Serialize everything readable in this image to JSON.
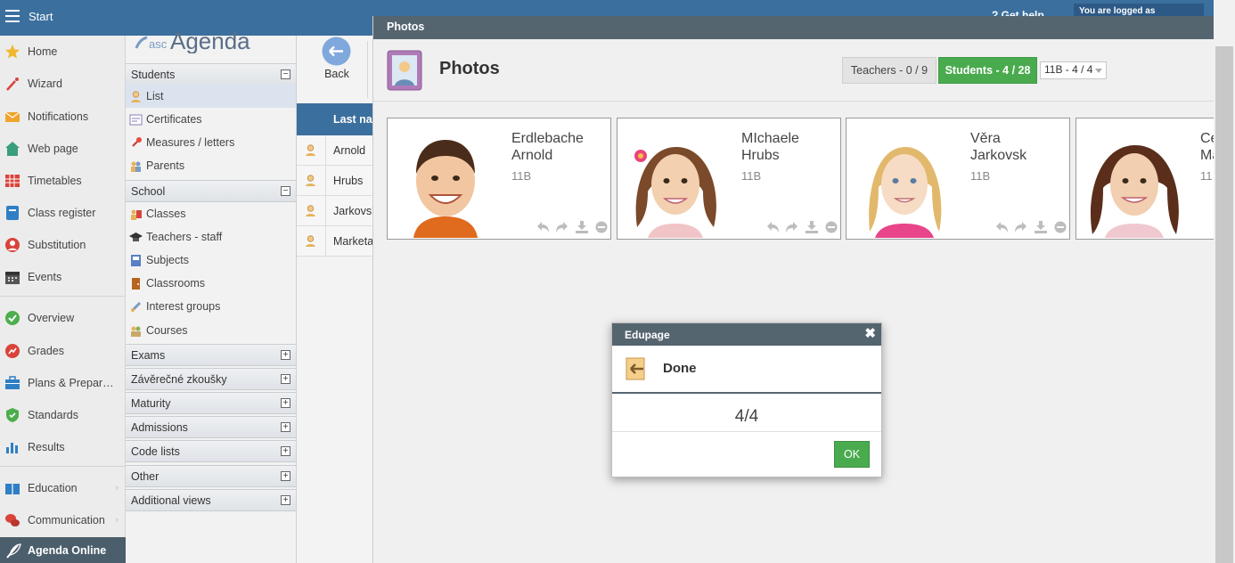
{
  "topbar": {
    "start_label": "Start",
    "help_label": "? Get help",
    "logged_label": "You are logged as"
  },
  "leftnav": {
    "items": [
      {
        "label": "Home",
        "icon": "star-icon",
        "color": "#f0b72c"
      },
      {
        "label": "Wizard",
        "icon": "wand-icon",
        "color": "#d9433a"
      },
      {
        "label": "Notifications",
        "icon": "envelope-icon",
        "color": "#f0a42c"
      },
      {
        "label": "Web page",
        "icon": "house-icon",
        "color": "#3a9e7c"
      },
      {
        "label": "Timetables",
        "icon": "grid-icon",
        "color": "#d9433a"
      },
      {
        "label": "Class register",
        "icon": "book-icon",
        "color": "#2f7fc4"
      },
      {
        "label": "Substitution",
        "icon": "person-icon",
        "color": "#d9433a"
      },
      {
        "label": "Events",
        "icon": "calendar-icon",
        "color": "#555555"
      },
      {
        "label": "Overview",
        "icon": "check-circle-icon",
        "color": "#4cae4c"
      },
      {
        "label": "Grades",
        "icon": "chart-circle-icon",
        "color": "#d9433a"
      },
      {
        "label": "Plans & Prepar…",
        "icon": "briefcase-icon",
        "color": "#2f7fc4"
      },
      {
        "label": "Standards",
        "icon": "shield-icon",
        "color": "#4cae4c"
      },
      {
        "label": "Results",
        "icon": "bar-chart-icon",
        "color": "#2f7fc4"
      },
      {
        "label": "Education",
        "icon": "books-icon",
        "color": "#2f7fc4"
      },
      {
        "label": "Communication",
        "icon": "chat-icon",
        "color": "#d9433a"
      }
    ],
    "agenda_online": "Agenda Online"
  },
  "subnav": {
    "logo_text": "ascAgenda",
    "students_head": "Students",
    "students_items": [
      "List",
      "Certificates",
      "Measures / letters",
      "Parents"
    ],
    "school_head": "School",
    "school_items": [
      "Classes",
      "Teachers - staff",
      "Subjects",
      "Classrooms",
      "Interest groups",
      "Courses"
    ],
    "collapsed_sections": [
      "Exams",
      "Závěrečné zkoušky",
      "Maturity",
      "Admissions",
      "Code lists",
      "Other",
      "Additional views"
    ]
  },
  "toolbar": {
    "back_label": "Back"
  },
  "bg_table": {
    "header": "Last na",
    "rows": [
      "Arnold",
      "Hrubs",
      "Jarkovsk",
      "Marketa"
    ]
  },
  "photos": {
    "window_title": "Photos",
    "title": "Photos",
    "teachers_tab": "Teachers - 0 / 9",
    "students_tab": "Students - 4 / 28",
    "class_select": "11B - 4 / 4",
    "cards": [
      {
        "name1": "Erdlebache",
        "name2": "Arnold",
        "cls": "11B"
      },
      {
        "name1": "MIchaele",
        "name2": "Hrubs",
        "cls": "11B"
      },
      {
        "name1": "Věra",
        "name2": "Jarkovsk",
        "cls": "11B"
      },
      {
        "name1": "Ce",
        "name2": "Ma",
        "cls": "11"
      }
    ]
  },
  "dialog": {
    "title": "Edupage",
    "close_glyph": "✖",
    "heading": "Done",
    "message": "4/4",
    "ok_label": "OK"
  },
  "colors": {
    "topbar": "#3b6f9e",
    "window_header": "#556570",
    "green": "#4aab4e"
  }
}
